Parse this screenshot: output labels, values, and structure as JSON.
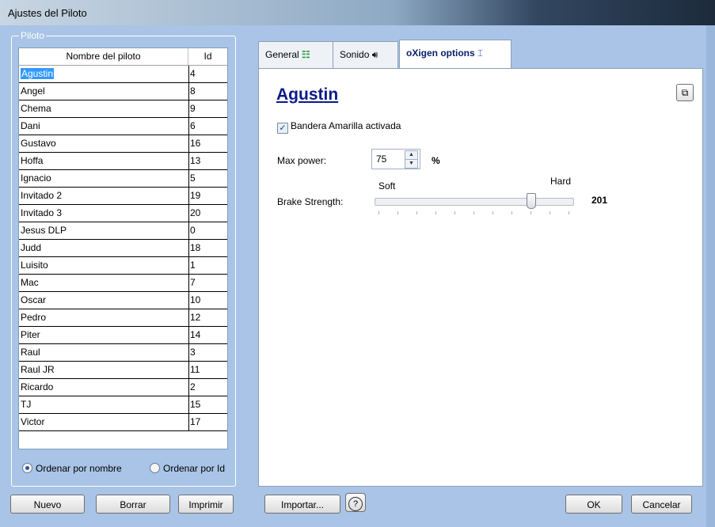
{
  "window": {
    "title": "Ajustes del Piloto"
  },
  "group": {
    "title": "Piloto"
  },
  "table": {
    "columns": [
      "Nombre del piloto",
      "Id"
    ],
    "rows": [
      {
        "name": "Agustin",
        "id": "4"
      },
      {
        "name": "Angel",
        "id": "8"
      },
      {
        "name": "Chema",
        "id": "9"
      },
      {
        "name": "Dani",
        "id": "6"
      },
      {
        "name": "Gustavo",
        "id": "16"
      },
      {
        "name": "Hoffa",
        "id": "13"
      },
      {
        "name": "Ignacio",
        "id": "5"
      },
      {
        "name": "Invitado 2",
        "id": "19"
      },
      {
        "name": "Invitado 3",
        "id": "20"
      },
      {
        "name": "Jesus DLP",
        "id": "0"
      },
      {
        "name": "Judd",
        "id": "18"
      },
      {
        "name": "Luisito",
        "id": "1"
      },
      {
        "name": "Mac",
        "id": "7"
      },
      {
        "name": "Oscar",
        "id": "10"
      },
      {
        "name": "Pedro",
        "id": "12"
      },
      {
        "name": "Piter",
        "id": "14"
      },
      {
        "name": "Raul",
        "id": "3"
      },
      {
        "name": "Raul JR",
        "id": "11"
      },
      {
        "name": "Ricardo",
        "id": "2"
      },
      {
        "name": "TJ",
        "id": "15"
      },
      {
        "name": "Victor",
        "id": "17"
      }
    ],
    "selected_index": 0
  },
  "sort": {
    "by_name": "Ordenar por nombre",
    "by_id": "Ordenar por Id",
    "selected": "by_name"
  },
  "buttons": {
    "new": "Nuevo",
    "delete": "Borrar",
    "print": "Imprimir",
    "import": "Importar...",
    "help": "?",
    "ok": "OK",
    "cancel": "Cancelar"
  },
  "tabs": [
    {
      "label": "General",
      "icon": "grid-icon"
    },
    {
      "label": "Sonido",
      "icon": "speaker-icon"
    },
    {
      "label": "oXigen options",
      "icon": "tool-icon",
      "active": true
    }
  ],
  "options": {
    "pilot_name": "Agustin",
    "yellow_flag_label": "Bandera Amarilla activada",
    "yellow_flag_checked": true,
    "max_power_label": "Max power:",
    "max_power_value": "75",
    "max_power_unit": "%",
    "brake_label": "Brake Strength:",
    "brake_soft": "Soft",
    "brake_hard": "Hard",
    "brake_value": "201",
    "brake_fraction": 0.79
  },
  "colors": {
    "background": "#a9c4e6",
    "selection": "#3399ff",
    "pilot_name": "#0a1a8a"
  }
}
